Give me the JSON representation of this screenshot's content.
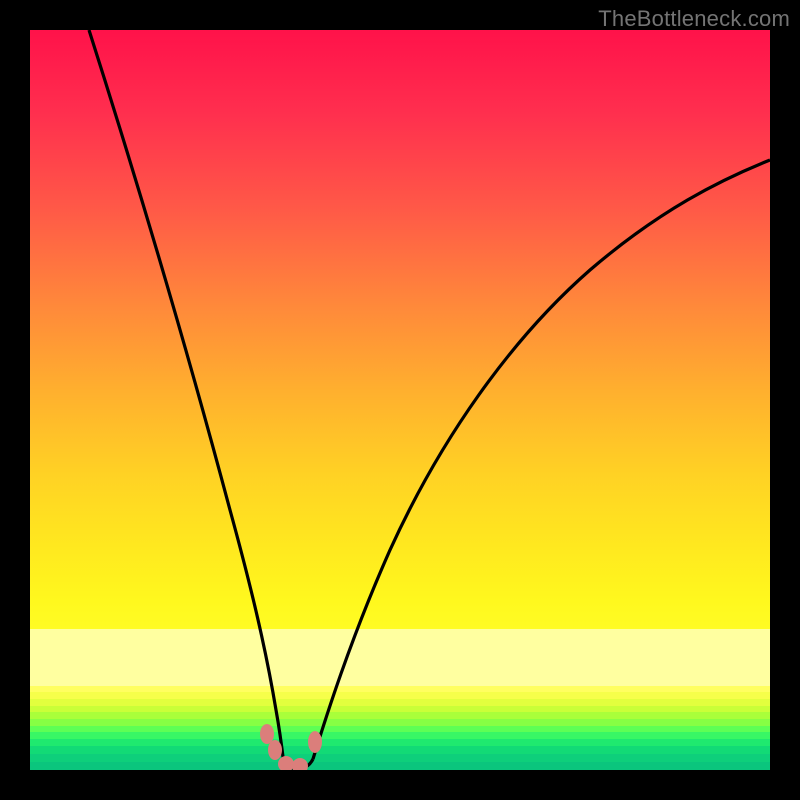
{
  "watermark": "TheBottleneck.com",
  "colors": {
    "black": "#000000",
    "marker": "#db7e7b",
    "curve_stroke": "#000000"
  },
  "chart_data": {
    "type": "line",
    "title": "",
    "xlabel": "",
    "ylabel": "",
    "xlim": [
      0,
      100
    ],
    "ylim": [
      0,
      100
    ],
    "grid": false,
    "legend": false,
    "note": "No numeric axis ticks or labels are rendered in the image; values below are estimated from pixel positions on a 0–100 normalized scale for each axis.",
    "series": [
      {
        "name": "left-branch",
        "x": [
          8,
          12,
          16,
          20,
          24,
          27,
          29,
          30.5,
          31.5,
          32.5,
          33.5,
          34.2
        ],
        "y": [
          100,
          84,
          68,
          52,
          37,
          24,
          15,
          9,
          6,
          3.5,
          1.5,
          0
        ]
      },
      {
        "name": "right-branch",
        "x": [
          37.5,
          39,
          41,
          44,
          48,
          53,
          59,
          66,
          74,
          83,
          92,
          100
        ],
        "y": [
          0,
          2,
          6,
          13,
          22,
          32,
          43,
          53,
          62,
          70,
          77,
          82
        ]
      },
      {
        "name": "valley-floor",
        "x": [
          34.2,
          35.5,
          36.5,
          37.5
        ],
        "y": [
          0,
          0,
          0,
          0
        ]
      }
    ],
    "markers": [
      {
        "x": 31.9,
        "y": 4.2
      },
      {
        "x": 33.0,
        "y": 2.2
      },
      {
        "x": 34.3,
        "y": 0.5
      },
      {
        "x": 36.2,
        "y": 0.5
      },
      {
        "x": 38.4,
        "y": 4.0
      }
    ],
    "gradient_bands": [
      {
        "from_y": 0,
        "to_y": 78,
        "desc": "red→orange→yellow vertical gradient"
      },
      {
        "from_y": 78,
        "to_y": 88,
        "desc": "pale yellow plateau"
      },
      {
        "from_y": 88,
        "to_y": 100,
        "desc": "yellow-green→green thin bands"
      }
    ]
  }
}
